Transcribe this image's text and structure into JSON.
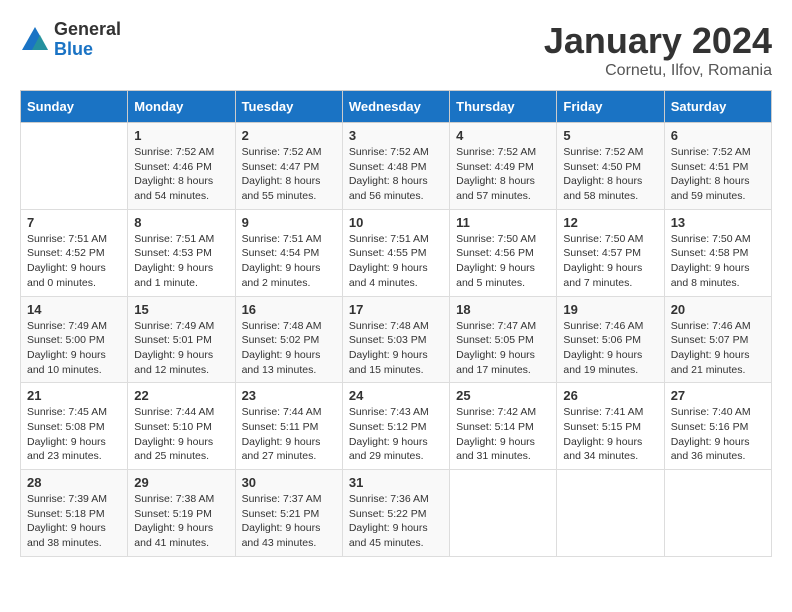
{
  "logo": {
    "general": "General",
    "blue": "Blue"
  },
  "header": {
    "title": "January 2024",
    "subtitle": "Cornetu, Ilfov, Romania"
  },
  "weekdays": [
    "Sunday",
    "Monday",
    "Tuesday",
    "Wednesday",
    "Thursday",
    "Friday",
    "Saturday"
  ],
  "weeks": [
    [
      {
        "day": "",
        "info": ""
      },
      {
        "day": "1",
        "info": "Sunrise: 7:52 AM\nSunset: 4:46 PM\nDaylight: 8 hours\nand 54 minutes."
      },
      {
        "day": "2",
        "info": "Sunrise: 7:52 AM\nSunset: 4:47 PM\nDaylight: 8 hours\nand 55 minutes."
      },
      {
        "day": "3",
        "info": "Sunrise: 7:52 AM\nSunset: 4:48 PM\nDaylight: 8 hours\nand 56 minutes."
      },
      {
        "day": "4",
        "info": "Sunrise: 7:52 AM\nSunset: 4:49 PM\nDaylight: 8 hours\nand 57 minutes."
      },
      {
        "day": "5",
        "info": "Sunrise: 7:52 AM\nSunset: 4:50 PM\nDaylight: 8 hours\nand 58 minutes."
      },
      {
        "day": "6",
        "info": "Sunrise: 7:52 AM\nSunset: 4:51 PM\nDaylight: 8 hours\nand 59 minutes."
      }
    ],
    [
      {
        "day": "7",
        "info": "Sunrise: 7:51 AM\nSunset: 4:52 PM\nDaylight: 9 hours\nand 0 minutes."
      },
      {
        "day": "8",
        "info": "Sunrise: 7:51 AM\nSunset: 4:53 PM\nDaylight: 9 hours\nand 1 minute."
      },
      {
        "day": "9",
        "info": "Sunrise: 7:51 AM\nSunset: 4:54 PM\nDaylight: 9 hours\nand 2 minutes."
      },
      {
        "day": "10",
        "info": "Sunrise: 7:51 AM\nSunset: 4:55 PM\nDaylight: 9 hours\nand 4 minutes."
      },
      {
        "day": "11",
        "info": "Sunrise: 7:50 AM\nSunset: 4:56 PM\nDaylight: 9 hours\nand 5 minutes."
      },
      {
        "day": "12",
        "info": "Sunrise: 7:50 AM\nSunset: 4:57 PM\nDaylight: 9 hours\nand 7 minutes."
      },
      {
        "day": "13",
        "info": "Sunrise: 7:50 AM\nSunset: 4:58 PM\nDaylight: 9 hours\nand 8 minutes."
      }
    ],
    [
      {
        "day": "14",
        "info": "Sunrise: 7:49 AM\nSunset: 5:00 PM\nDaylight: 9 hours\nand 10 minutes."
      },
      {
        "day": "15",
        "info": "Sunrise: 7:49 AM\nSunset: 5:01 PM\nDaylight: 9 hours\nand 12 minutes."
      },
      {
        "day": "16",
        "info": "Sunrise: 7:48 AM\nSunset: 5:02 PM\nDaylight: 9 hours\nand 13 minutes."
      },
      {
        "day": "17",
        "info": "Sunrise: 7:48 AM\nSunset: 5:03 PM\nDaylight: 9 hours\nand 15 minutes."
      },
      {
        "day": "18",
        "info": "Sunrise: 7:47 AM\nSunset: 5:05 PM\nDaylight: 9 hours\nand 17 minutes."
      },
      {
        "day": "19",
        "info": "Sunrise: 7:46 AM\nSunset: 5:06 PM\nDaylight: 9 hours\nand 19 minutes."
      },
      {
        "day": "20",
        "info": "Sunrise: 7:46 AM\nSunset: 5:07 PM\nDaylight: 9 hours\nand 21 minutes."
      }
    ],
    [
      {
        "day": "21",
        "info": "Sunrise: 7:45 AM\nSunset: 5:08 PM\nDaylight: 9 hours\nand 23 minutes."
      },
      {
        "day": "22",
        "info": "Sunrise: 7:44 AM\nSunset: 5:10 PM\nDaylight: 9 hours\nand 25 minutes."
      },
      {
        "day": "23",
        "info": "Sunrise: 7:44 AM\nSunset: 5:11 PM\nDaylight: 9 hours\nand 27 minutes."
      },
      {
        "day": "24",
        "info": "Sunrise: 7:43 AM\nSunset: 5:12 PM\nDaylight: 9 hours\nand 29 minutes."
      },
      {
        "day": "25",
        "info": "Sunrise: 7:42 AM\nSunset: 5:14 PM\nDaylight: 9 hours\nand 31 minutes."
      },
      {
        "day": "26",
        "info": "Sunrise: 7:41 AM\nSunset: 5:15 PM\nDaylight: 9 hours\nand 34 minutes."
      },
      {
        "day": "27",
        "info": "Sunrise: 7:40 AM\nSunset: 5:16 PM\nDaylight: 9 hours\nand 36 minutes."
      }
    ],
    [
      {
        "day": "28",
        "info": "Sunrise: 7:39 AM\nSunset: 5:18 PM\nDaylight: 9 hours\nand 38 minutes."
      },
      {
        "day": "29",
        "info": "Sunrise: 7:38 AM\nSunset: 5:19 PM\nDaylight: 9 hours\nand 41 minutes."
      },
      {
        "day": "30",
        "info": "Sunrise: 7:37 AM\nSunset: 5:21 PM\nDaylight: 9 hours\nand 43 minutes."
      },
      {
        "day": "31",
        "info": "Sunrise: 7:36 AM\nSunset: 5:22 PM\nDaylight: 9 hours\nand 45 minutes."
      },
      {
        "day": "",
        "info": ""
      },
      {
        "day": "",
        "info": ""
      },
      {
        "day": "",
        "info": ""
      }
    ]
  ]
}
